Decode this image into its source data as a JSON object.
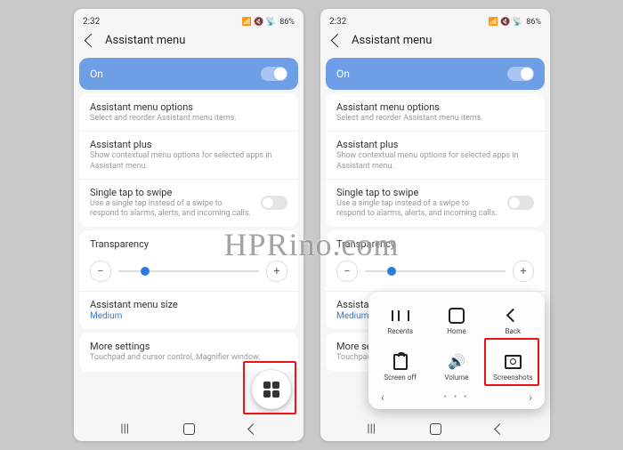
{
  "watermark": "HPRino.com",
  "status": {
    "time": "2:32",
    "battery": "86%",
    "icons": "📶 🔇 📡"
  },
  "header": {
    "title": "Assistant menu"
  },
  "mainToggle": {
    "label": "On",
    "on": true
  },
  "options": {
    "opt1": {
      "title": "Assistant menu options",
      "sub": "Select and reorder Assistant menu items."
    },
    "opt2": {
      "title": "Assistant plus",
      "sub": "Show contextual menu options for selected apps in Assistant menu."
    },
    "opt3": {
      "title": "Single tap to swipe",
      "sub": "Use a single tap instead of a swipe to respond to alarms, alerts, and incoming calls."
    }
  },
  "transparency": {
    "title": "Transparency",
    "minus": "−",
    "plus": "+"
  },
  "size": {
    "title": "Assistant menu size",
    "value": "Medium"
  },
  "more": {
    "title": "More settings",
    "sub": "Touchpad and cursor control, Magnifier window."
  },
  "popup": {
    "recents": "Recents",
    "home": "Home",
    "back": "Back",
    "screenoff": "Screen off",
    "volume": "Volume",
    "screenshots": "Screenshots",
    "dots": "•  •  •",
    "left": "‹",
    "right": "›"
  },
  "nav": {
    "recents": "|||"
  }
}
